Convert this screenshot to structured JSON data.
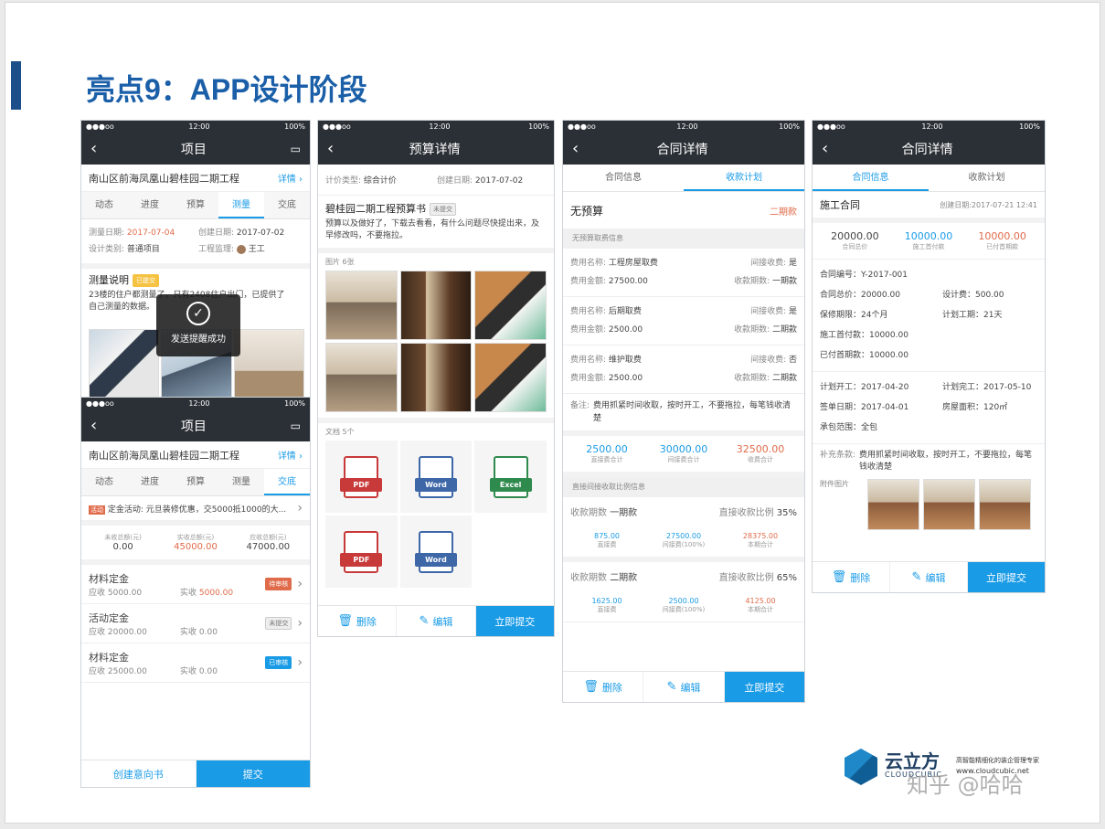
{
  "slide": {
    "title": "亮点9：APP设计阶段"
  },
  "status": {
    "time": "12:00",
    "battery": "100%",
    "signal": "●●●oo"
  },
  "phone1": {
    "nav_title": "项目",
    "project_name": "南山区前海凤凰山碧桂园二期工程",
    "detail_link": "详情",
    "tabs": [
      "动态",
      "进度",
      "预算",
      "测量",
      "交底"
    ],
    "active_tab": "测量",
    "info": {
      "measure_date_label": "测量日期:",
      "measure_date": "2017-07-04",
      "create_date_label": "创建日期:",
      "create_date": "2017-07-02",
      "design_cat_label": "设计类别:",
      "design_cat": "普通项目",
      "supervisor_label": "工程监理:",
      "supervisor": "王工"
    },
    "measure_title": "测量说明",
    "measure_badge": "已提交",
    "measure_text_1": "23楼的住户都测量了，只有",
    "measure_text_1_tail": "2408住户出门，已提供了",
    "measure_text_2": "自己测量的数据。",
    "toast": "发送提醒成功"
  },
  "phone1b": {
    "nav_title": "项目",
    "project_name": "南山区前海凤凰山碧桂园二期工程",
    "detail_link": "详情",
    "tabs": [
      "动态",
      "进度",
      "预算",
      "测量",
      "交底"
    ],
    "active_tab": "交底",
    "promo_tag": "活动",
    "promo_text": "定金活动: 元旦装修优惠，交5000抵1000的大...",
    "totals": [
      {
        "label": "未收总额(元)",
        "value": "0.00"
      },
      {
        "label": "实收总额(元)",
        "value": "45000.00"
      },
      {
        "label": "应收总额(元)",
        "value": "47000.00"
      }
    ],
    "deposits": [
      {
        "name": "材料定金",
        "due": "应收 5000.00",
        "paid_label": "实收",
        "paid": "5000.00",
        "status": "待审核"
      },
      {
        "name": "活动定金",
        "due": "应收 20000.00",
        "paid_label": "实收",
        "paid": "0.00",
        "status": "未提交"
      },
      {
        "name": "材料定金",
        "due": "应收 25000.00",
        "paid_label": "实收",
        "paid": "0.00",
        "status": "已审核"
      }
    ],
    "btn_create": "创建意向书",
    "btn_submit": "提交"
  },
  "phone2": {
    "nav_title": "预算详情",
    "pricing_label": "计价类型:",
    "pricing": "综合计价",
    "create_label": "创建日期:",
    "create_date": "2017-07-02",
    "budget_title": "碧桂园二期工程预算书",
    "budget_badge": "未提交",
    "budget_desc": "预算以及做好了，下载去看看，有什么问题尽快提出来，及早修改吗，不要拖拉。",
    "pictures_label": "图片",
    "pictures_count": "6张",
    "docs_label": "文档",
    "docs_count": "5个",
    "docs": [
      "PDF",
      "Word",
      "Excel",
      "PDF",
      "Word"
    ],
    "btn_delete": "删除",
    "btn_edit": "编辑",
    "btn_submit": "立即提交"
  },
  "phone3": {
    "nav_title": "合同详情",
    "tabs": [
      "合同信息",
      "收款计划"
    ],
    "active_tab": "收款计划",
    "plan_title": "无预算",
    "plan_right": "二期款",
    "sec1": "无预算取费信息",
    "fees": [
      {
        "name": "工程房屋取费",
        "amount": "27500.00",
        "indirect": "是",
        "period": "一期款"
      },
      {
        "name": "后期取费",
        "amount": "2500.00",
        "indirect": "是",
        "period": "二期款"
      },
      {
        "name": "维护取费",
        "amount": "2500.00",
        "indirect": "否",
        "period": "二期款"
      }
    ],
    "fee_name_label": "费用名称:",
    "fee_amount_label": "费用金额:",
    "indirect_label": "间接收费:",
    "period_label": "收款期数:",
    "remark_label": "备注:",
    "remark": "费用抓紧时间收取，按时开工，不要拖拉，每笔钱收清楚",
    "summary": [
      {
        "value": "2500.00",
        "label": "直接费合计"
      },
      {
        "value": "30000.00",
        "label": "间接费合计"
      },
      {
        "value": "32500.00",
        "label": "收费合计"
      }
    ],
    "sec2": "直接间接收取比例信息",
    "periods": [
      {
        "period_label": "收款期数",
        "period": "一期款",
        "ratio_label": "直接收款比例",
        "ratio": "35%",
        "vals": [
          {
            "v": "875.00",
            "l": "直接费"
          },
          {
            "v": "27500.00",
            "l": "间接费(100%)"
          },
          {
            "v": "28375.00",
            "l": "本期合计"
          }
        ]
      },
      {
        "period_label": "收款期数",
        "period": "二期款",
        "ratio_label": "直接收款比例",
        "ratio": "65%",
        "vals": [
          {
            "v": "1625.00",
            "l": "直接费"
          },
          {
            "v": "2500.00",
            "l": "间接费(100%)"
          },
          {
            "v": "4125.00",
            "l": "本期合计"
          }
        ]
      }
    ],
    "btn_delete": "删除",
    "btn_edit": "编辑",
    "btn_submit": "立即提交"
  },
  "phone4": {
    "nav_title": "合同详情",
    "tabs": [
      "合同信息",
      "收款计划"
    ],
    "active_tab": "合同信息",
    "contract_title": "施工合同",
    "create_date": "创建日期:2017-07-21 12:41",
    "summary": [
      {
        "value": "20000.00",
        "label": "合同总价"
      },
      {
        "value": "10000.00",
        "label": "施工首付款"
      },
      {
        "value": "10000.00",
        "label": "已付首期款"
      }
    ],
    "fields": {
      "no": "合同编号：Y-2017-001",
      "total": "合同总价：20000.00",
      "design": "设计费：500.00",
      "warranty": "保修期限：24个月",
      "plan_days": "计划工期：21天",
      "first_pay": "施工首付款：10000.00",
      "paid": "已付首期款：10000.00",
      "start": "计划开工：2017-04-20",
      "end": "计划完工：2017-05-10",
      "sign": "签单日期：2017-04-01",
      "area": "房屋面积：120㎡",
      "scope": "承包范围：全包"
    },
    "extra_label": "补充条款:",
    "extra": "费用抓紧时间收取，按时开工，不要拖拉，每笔钱收清楚",
    "attach_label": "附件图片",
    "btn_delete": "删除",
    "btn_edit": "编辑",
    "btn_submit": "立即提交"
  },
  "logo": {
    "brand": "云立方",
    "brand_en": "CLOUDCUBIC",
    "tagline": "高智能精细化的装企管理专家",
    "url": "www.cloudcubic.net"
  },
  "watermark": "知乎 @哈哈",
  "colors": {
    "accent": "#1a9be6",
    "dark": "#2b3036",
    "red": "#e06b4a",
    "title": "#1b5fa8"
  }
}
